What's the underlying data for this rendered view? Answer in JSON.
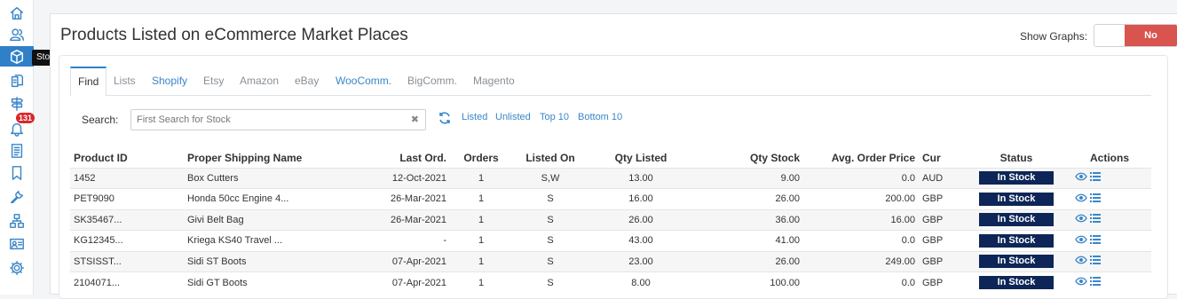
{
  "sidebar": {
    "items": [
      {
        "icon": "home-icon"
      },
      {
        "icon": "customers-icon"
      },
      {
        "icon": "stock-box-icon",
        "active": true,
        "tooltip": "Stock"
      },
      {
        "icon": "documents-icon"
      },
      {
        "icon": "signpost-icon"
      },
      {
        "icon": "notifications-bell-icon",
        "badge": "131"
      },
      {
        "icon": "orders-list-icon"
      },
      {
        "icon": "bookmark-icon"
      },
      {
        "icon": "wrench-icon"
      },
      {
        "icon": "sitemap-icon"
      },
      {
        "icon": "contact-card-icon"
      },
      {
        "icon": "settings-gear-icon"
      }
    ]
  },
  "header": {
    "title": "Products Listed on eCommerce Market Places",
    "show_graphs_label": "Show Graphs:",
    "show_graphs_value": "No"
  },
  "tabs": [
    {
      "label": "Find",
      "active": true
    },
    {
      "label": "Lists"
    },
    {
      "label": "Shopify",
      "link": true
    },
    {
      "label": "Etsy"
    },
    {
      "label": "Amazon"
    },
    {
      "label": "eBay"
    },
    {
      "label": "WooComm.",
      "link": true
    },
    {
      "label": "BigComm."
    },
    {
      "label": "Magento"
    }
  ],
  "search": {
    "label": "Search:",
    "placeholder": "First Search for Stock",
    "value": "",
    "clear": "✖",
    "filters": [
      "Listed",
      "Unlisted",
      "Top 10",
      "Bottom 10"
    ]
  },
  "table": {
    "columns": [
      "Product ID",
      "Proper Shipping Name",
      "Last Ord.",
      "Orders",
      "Listed On",
      "Qty Listed",
      "Qty Stock",
      "Avg. Order Price",
      "Cur",
      "Status",
      "Actions"
    ],
    "rows": [
      {
        "id": "1452",
        "name": "Box Cutters",
        "last": "12-Oct-2021",
        "orders": "1",
        "listed_on": "S,W",
        "qty_listed": "13.00",
        "qty_stock": "9.00",
        "avg": "0.0",
        "cur": "AUD",
        "status": "In Stock"
      },
      {
        "id": "PET9090",
        "name": "Honda 50cc Engine 4...",
        "last": "26-Mar-2021",
        "orders": "1",
        "listed_on": "S",
        "qty_listed": "16.00",
        "qty_stock": "26.00",
        "avg": "200.00",
        "cur": "GBP",
        "status": "In Stock"
      },
      {
        "id": "SK35467...",
        "name": "Givi Belt Bag",
        "last": "26-Mar-2021",
        "orders": "1",
        "listed_on": "S",
        "qty_listed": "26.00",
        "qty_stock": "36.00",
        "avg": "16.00",
        "cur": "GBP",
        "status": "In Stock"
      },
      {
        "id": "KG12345...",
        "name": "Kriega KS40 Travel ...",
        "last": "-",
        "orders": "1",
        "listed_on": "S",
        "qty_listed": "43.00",
        "qty_stock": "41.00",
        "avg": "0.0",
        "cur": "GBP",
        "status": "In Stock"
      },
      {
        "id": "STSISST...",
        "name": "Sidi ST Boots",
        "last": "07-Apr-2021",
        "orders": "1",
        "listed_on": "S",
        "qty_listed": "23.00",
        "qty_stock": "26.00",
        "avg": "249.00",
        "cur": "GBP",
        "status": "In Stock"
      },
      {
        "id": "2104071...",
        "name": "Sidi GT Boots",
        "last": "07-Apr-2021",
        "orders": "1",
        "listed_on": "S",
        "qty_listed": "8.00",
        "qty_stock": "100.00",
        "avg": "0.0",
        "cur": "GBP",
        "status": "In Stock"
      }
    ]
  },
  "colors": {
    "accent": "#2f80c9",
    "status_badge": "#0d2657",
    "toggle_no": "#d9534f",
    "notification_badge": "#d9262c"
  }
}
